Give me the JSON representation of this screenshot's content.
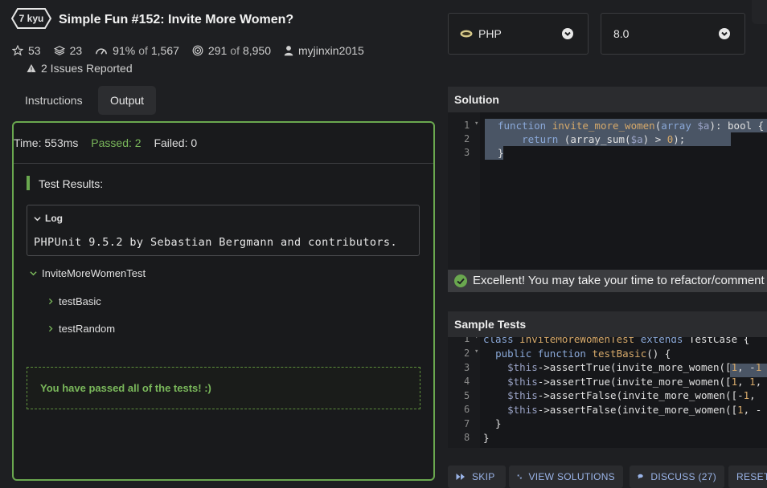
{
  "kata": {
    "rank": "7 kyu",
    "title": "Simple Fun #152: Invite More Women?",
    "stars": "53",
    "collections": "23",
    "satisfaction": "91%",
    "satisfaction_of": "of",
    "satisfaction_votes": "1,567",
    "completed": "291",
    "completed_of": "of",
    "completed_total": "8,950",
    "author": "myjinxin2015",
    "issues": "2 Issues Reported"
  },
  "tabs": [
    {
      "label": "Instructions"
    },
    {
      "label": "Output"
    }
  ],
  "output": {
    "time": "Time: 553ms",
    "passed": "Passed: 2",
    "failed": "Failed: 0",
    "results_label": "Test Results:",
    "log_label": "Log",
    "log_text": "PHPUnit 9.5.2 by Sebastian Bergmann and contributors.",
    "suite": "InviteMoreWomenTest",
    "tests": [
      "testBasic",
      "testRandom"
    ],
    "pass_message": "You have passed all of the tests! :)"
  },
  "language": {
    "selected": "PHP",
    "version": "8.0"
  },
  "solution": {
    "header": "Solution",
    "line_numbers": [
      "1",
      "2",
      "3"
    ],
    "success_message": "Excellent! You may take your time to refactor/comment y"
  },
  "sample_tests": {
    "header": "Sample Tests",
    "line_numbers": [
      "1",
      "2",
      "3",
      "4",
      "5",
      "6",
      "7",
      "8"
    ]
  },
  "buttons": {
    "skip": "SKIP",
    "view_solutions": "VIEW SOLUTIONS",
    "discuss": "DISCUSS (27)",
    "reset": "RESET"
  },
  "colors": {
    "background": "#1e1f22",
    "accent_green": "#6aa84f",
    "link_blue": "#9ab4e8"
  }
}
